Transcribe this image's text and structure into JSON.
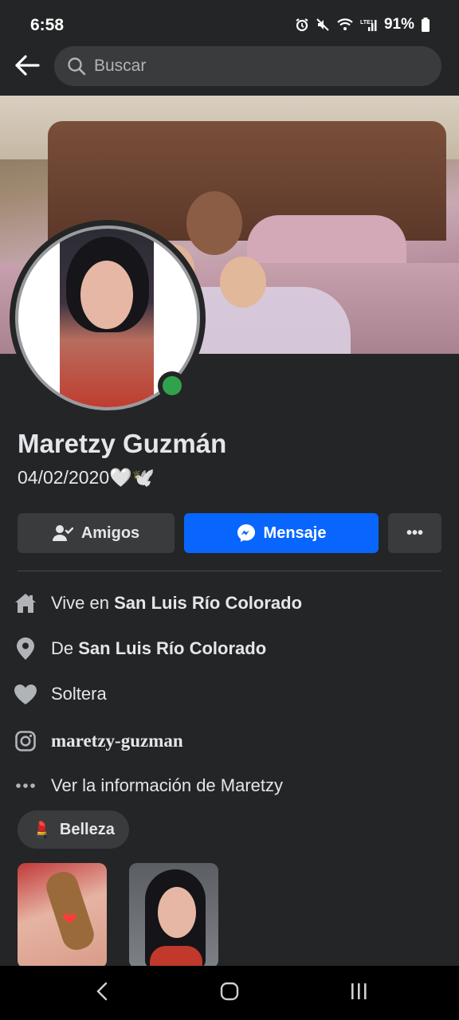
{
  "status_bar": {
    "time": "6:58",
    "battery": "91%"
  },
  "header": {
    "back_icon": "arrow-left-icon",
    "search_placeholder": "Buscar"
  },
  "profile": {
    "name": "Maretzy Guzmán",
    "bio": "04/02/2020🤍🕊️",
    "online": true,
    "online_color": "#31a24c"
  },
  "actions": {
    "friends_label": "Amigos",
    "message_label": "Mensaje",
    "more_label": "•••",
    "message_color": "#0866ff"
  },
  "details": [
    {
      "icon": "home-icon",
      "prefix": "Vive en",
      "value": "San Luis Río Colorado"
    },
    {
      "icon": "location-pin-icon",
      "prefix": "De",
      "value": "San Luis Río Colorado"
    },
    {
      "icon": "heart-icon",
      "prefix": "Soltera",
      "value": ""
    },
    {
      "icon": "instagram-icon",
      "prefix": "",
      "value": "maretzy-guzman"
    },
    {
      "icon": "more-dots-icon",
      "prefix": "Ver la información de Maretzy",
      "value": ""
    }
  ],
  "interests": {
    "chip_emoji": "💄",
    "chip_label": "Belleza"
  },
  "photos": [
    {
      "alt": "photo-thumbnail-1"
    },
    {
      "alt": "photo-thumbnail-2"
    }
  ]
}
